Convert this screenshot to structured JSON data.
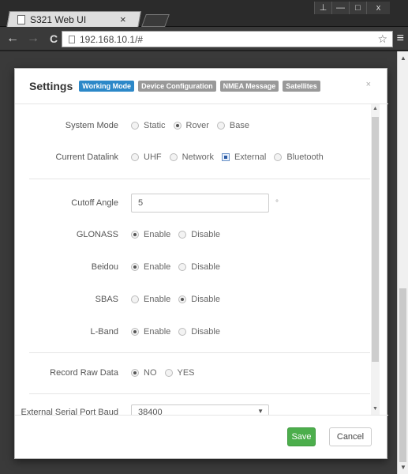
{
  "browser": {
    "tab_title": "S321 Web UI",
    "tab_close": "×",
    "url": "192.168.10.1/#",
    "window_controls": [
      "⊥",
      "—",
      "□",
      "x"
    ]
  },
  "modal": {
    "title": "Settings",
    "tabs": [
      "Working Mode",
      "Device Configuration",
      "NMEA Message",
      "Satellites"
    ],
    "active_tab": "Working Mode",
    "close": "×",
    "system_mode": {
      "label": "System Mode",
      "options": [
        "Static",
        "Rover",
        "Base"
      ],
      "selected": "Rover"
    },
    "datalink": {
      "label": "Current Datalink",
      "options": [
        "UHF",
        "Network",
        "External",
        "Bluetooth"
      ],
      "selected": "External"
    },
    "cutoff": {
      "label": "Cutoff Angle",
      "value": "5",
      "unit": "°"
    },
    "glonass": {
      "label": "GLONASS",
      "options": [
        "Enable",
        "Disable"
      ],
      "selected": "Enable"
    },
    "beidou": {
      "label": "Beidou",
      "options": [
        "Enable",
        "Disable"
      ],
      "selected": "Enable"
    },
    "sbas": {
      "label": "SBAS",
      "options": [
        "Enable",
        "Disable"
      ],
      "selected": "Disable"
    },
    "lband": {
      "label": "L-Band",
      "options": [
        "Enable",
        "Disable"
      ],
      "selected": "Enable"
    },
    "record_raw": {
      "label": "Record Raw Data",
      "options": [
        "NO",
        "YES"
      ],
      "selected": "NO"
    },
    "serial_baud": {
      "label": "External Serial Port Baud",
      "value": "38400"
    },
    "save": "Save",
    "cancel": "Cancel"
  },
  "colors": {
    "accent_tab": "#2c88c8",
    "save_button": "#4cae4c"
  }
}
